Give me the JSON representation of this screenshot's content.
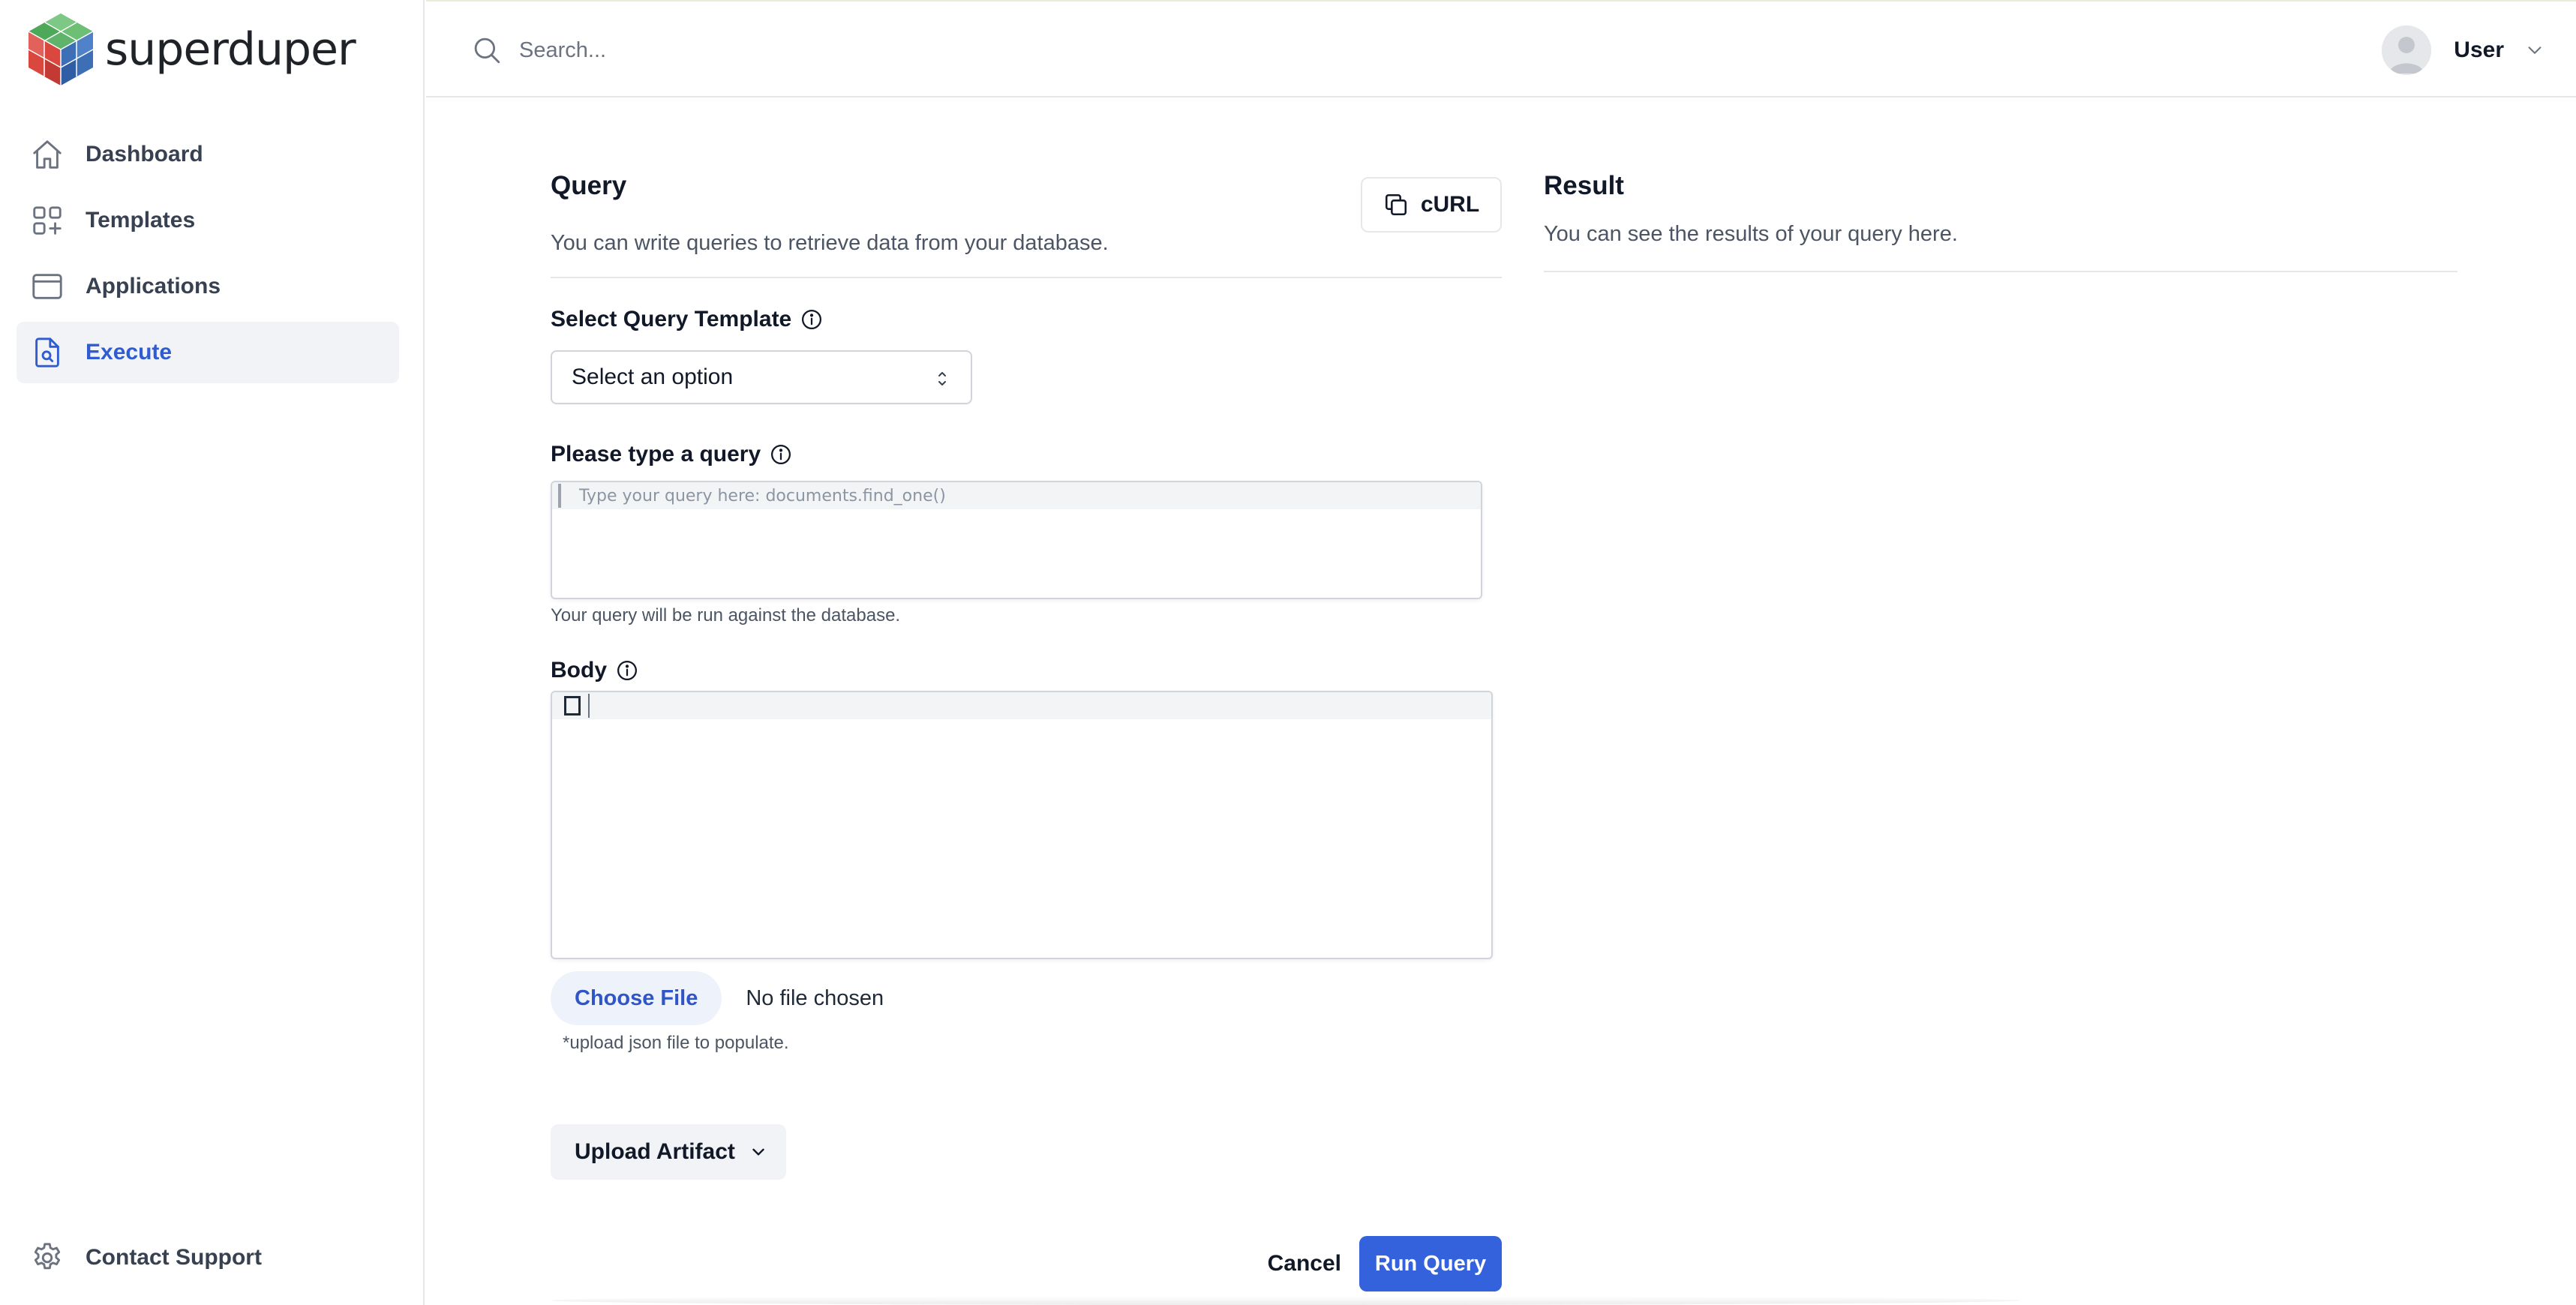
{
  "brand": {
    "name": "superduper"
  },
  "sidebar": {
    "items": [
      {
        "label": "Dashboard",
        "icon": "home-icon"
      },
      {
        "label": "Templates",
        "icon": "templates-icon"
      },
      {
        "label": "Applications",
        "icon": "window-icon"
      },
      {
        "label": "Execute",
        "icon": "document-search-icon",
        "active": true
      }
    ],
    "support": {
      "label": "Contact Support",
      "icon": "gear-icon"
    }
  },
  "topbar": {
    "search_placeholder": "Search...",
    "user_name": "User"
  },
  "query": {
    "title": "Query",
    "description": "You can write queries to retrieve data from your database.",
    "curl_label": "cURL",
    "template_label": "Select Query Template",
    "template_selected": "Select an option",
    "query_label": "Please type a query",
    "query_placeholder": "Type your query here: documents.find_one()",
    "query_hint": "Your query will be run against the database.",
    "body_label": "Body",
    "file_button": "Choose File",
    "file_status": "No file chosen",
    "file_hint": "*upload json file to populate.",
    "upload_artifact": "Upload Artifact",
    "cancel_label": "Cancel",
    "run_label": "Run Query"
  },
  "result": {
    "title": "Result",
    "description": "You can see the results of your query here."
  },
  "colors": {
    "accent": "#3461dc",
    "active_text": "#2f5bd3",
    "active_bg": "#f1f3f6",
    "logo_green": "#5fb36a",
    "logo_red": "#d9473f",
    "logo_blue": "#3d6fb6"
  }
}
